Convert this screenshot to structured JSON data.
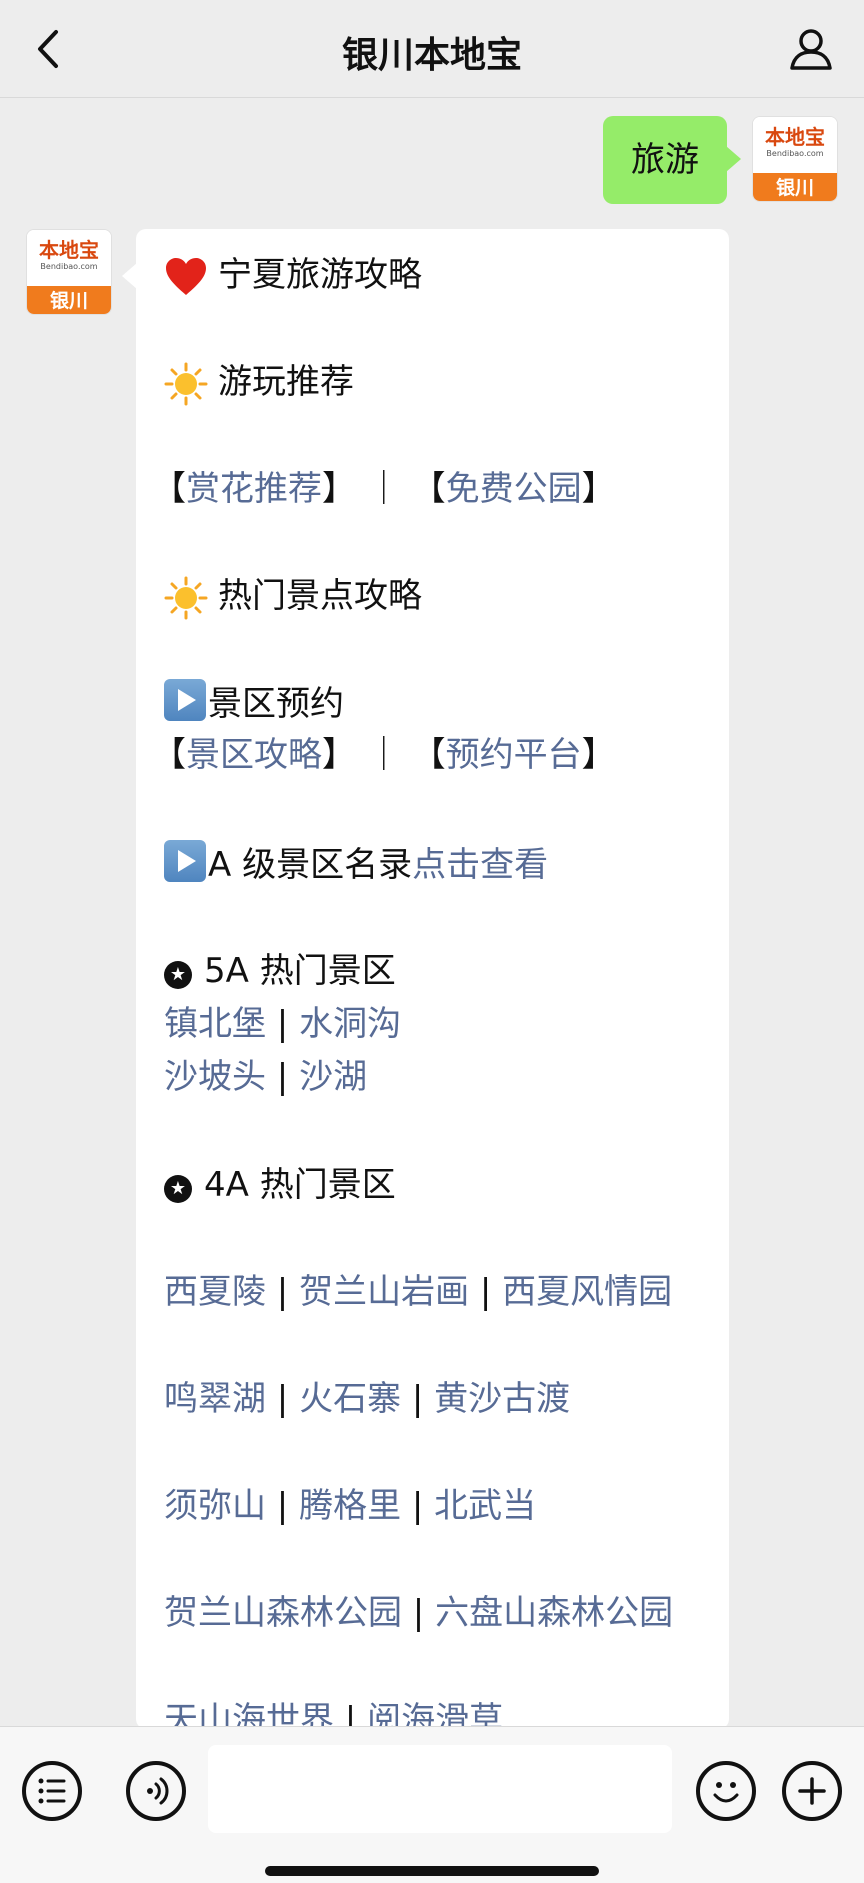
{
  "header": {
    "title": "银川本地宝",
    "back_icon": "chevron-left-icon",
    "profile_icon": "person-icon"
  },
  "avatar": {
    "brand": "本地宝",
    "url": "Bendibao.com",
    "city": "银川"
  },
  "outgoing_message": "旅游",
  "reply": {
    "heading": "宁夏旅游攻略",
    "recommend_title": "游玩推荐",
    "flower_link": "赏花推荐",
    "park_link": "免费公园",
    "hot_title": "热门景点攻略",
    "booking_title": "景区预约",
    "guide_link": "景区攻略",
    "platform_link": "预约平台",
    "a_list_text": "A 级景区名录",
    "a_list_link": "点击查看",
    "five_a_title": "5A 热门景区",
    "five_a": [
      "镇北堡",
      "水洞沟",
      "沙坡头",
      "沙湖"
    ],
    "four_a_title": "4A 热门景区",
    "four_a": [
      "西夏陵",
      "贺兰山岩画",
      "西夏风情园",
      "鸣翠湖",
      "火石寨",
      "黄沙古渡",
      "须弥山",
      "腾格里",
      "北武当",
      "贺兰山森林公园",
      "六盘山森林公园",
      "天山海世界",
      "阅海滑草"
    ]
  },
  "toolbar": {
    "voice_icon": "list-icon",
    "audio_icon": "voice-icon",
    "emoji_icon": "smiley-icon",
    "plus_icon": "plus-icon"
  },
  "colors": {
    "link": "#576b95",
    "bubble_green": "#95ec69",
    "background": "#ededed"
  }
}
